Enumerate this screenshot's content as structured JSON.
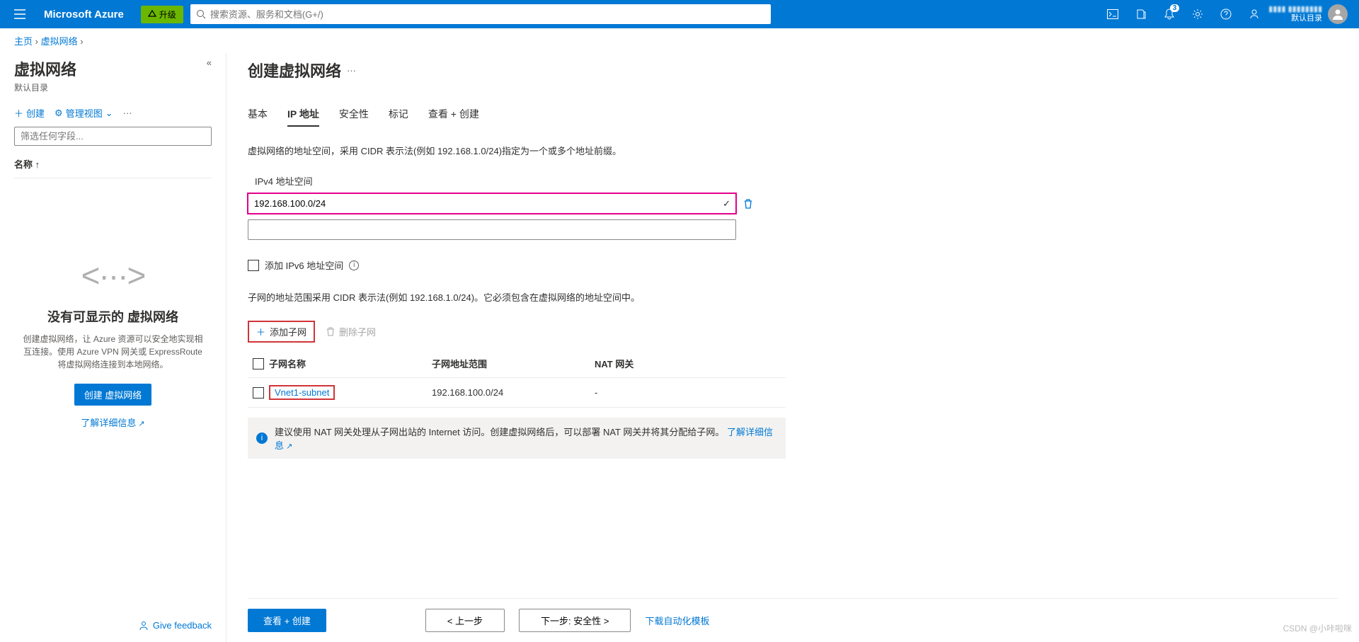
{
  "header": {
    "brand": "Microsoft Azure",
    "upgrade": "升级",
    "search_placeholder": "搜索资源、服务和文档(G+/)",
    "notif_count": "3",
    "user_name": "▮▮▮▮ ▮▮▮▮▮▮▮▮",
    "user_dir": "默认目录"
  },
  "breadcrumb": {
    "home": "主页",
    "sep": "›",
    "vnet": "虚拟网络"
  },
  "sidebar": {
    "title": "虚拟网络",
    "subtitle": "默认目录",
    "create": "创建",
    "manage_view": "管理视图",
    "filter_placeholder": "筛选任何字段...",
    "col_name": "名称 ↑",
    "empty_title": "没有可显示的 虚拟网络",
    "empty_desc": "创建虚拟网络，让 Azure 资源可以安全地实现相互连接。使用 Azure VPN 网关或 ExpressRoute 将虚拟网络连接到本地网络。",
    "create_btn": "创建 虚拟网络",
    "learn_more": "了解详细信息",
    "feedback": "Give feedback"
  },
  "main": {
    "title": "创建虚拟网络",
    "tabs": [
      "基本",
      "IP 地址",
      "安全性",
      "标记",
      "查看 + 创建"
    ],
    "active_tab": 1,
    "desc1": "虚拟网络的地址空间，采用 CIDR 表示法(例如 192.168.1.0/24)指定为一个或多个地址前缀。",
    "ipv4_label": "IPv4 地址空间",
    "ipv4_value": "192.168.100.0/24",
    "ipv6_cb": "添加 IPv6 地址空间",
    "desc2": "子网的地址范围采用 CIDR 表示法(例如 192.168.1.0/24)。它必须包含在虚拟网络的地址空间中。",
    "add_subnet": "添加子网",
    "del_subnet": "删除子网",
    "cols": {
      "name": "子网名称",
      "range": "子网地址范围",
      "nat": "NAT 网关"
    },
    "rows": [
      {
        "name": "Vnet1-subnet",
        "range": "192.168.100.0/24",
        "nat": "-"
      }
    ],
    "info": "建议使用 NAT 网关处理从子网出站的 Internet 访问。创建虚拟网络后，可以部署 NAT 网关并将其分配给子网。",
    "info_link": "了解详细信息",
    "footer": {
      "review": "查看 + 创建",
      "prev": "< 上一步",
      "next": "下一步: 安全性 >",
      "download": "下载自动化模板"
    }
  },
  "watermark": "CSDN @小咔啦咪"
}
